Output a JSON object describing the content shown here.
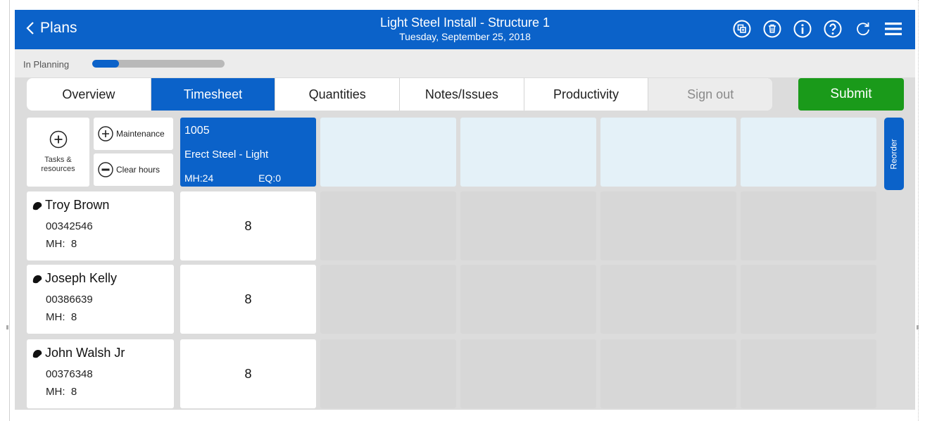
{
  "header": {
    "back_label": "Plans",
    "title": "Light Steel Install - Structure 1",
    "date": "Tuesday, September 25, 2018",
    "icons": [
      "copy-icon",
      "delete-icon",
      "info-icon",
      "help-icon",
      "refresh-icon",
      "menu-icon"
    ],
    "background": "#0b62c9"
  },
  "status": {
    "label": "In Planning",
    "progress_fraction": 0.2
  },
  "tabs": [
    {
      "label": "Overview",
      "state": "normal"
    },
    {
      "label": "Timesheet",
      "state": "active"
    },
    {
      "label": "Quantities",
      "state": "normal"
    },
    {
      "label": "Notes/Issues",
      "state": "normal"
    },
    {
      "label": "Productivity",
      "state": "normal"
    },
    {
      "label": "Sign out",
      "state": "disabled"
    }
  ],
  "submit_label": "Submit",
  "submit_color": "#1a9a1a",
  "tools": {
    "tasks_label_line1": "Tasks &",
    "tasks_label_line2": "resources",
    "maintenance_label": "Maintenance",
    "clear_hours_label": "Clear hours"
  },
  "tasks": [
    {
      "number": "1005",
      "name": "Erect Steel - Light",
      "mh": "MH:24",
      "eq": "EQ:0"
    }
  ],
  "reorder_label": "Reorder",
  "workers": [
    {
      "name": "Troy Brown",
      "id": "00342546",
      "mh": "MH:  8",
      "hours": "8"
    },
    {
      "name": "Joseph Kelly",
      "id": "00386639",
      "mh": "MH:  8",
      "hours": "8"
    },
    {
      "name": "John Walsh Jr",
      "id": "00376348",
      "mh": "MH:  8",
      "hours": "8"
    }
  ]
}
